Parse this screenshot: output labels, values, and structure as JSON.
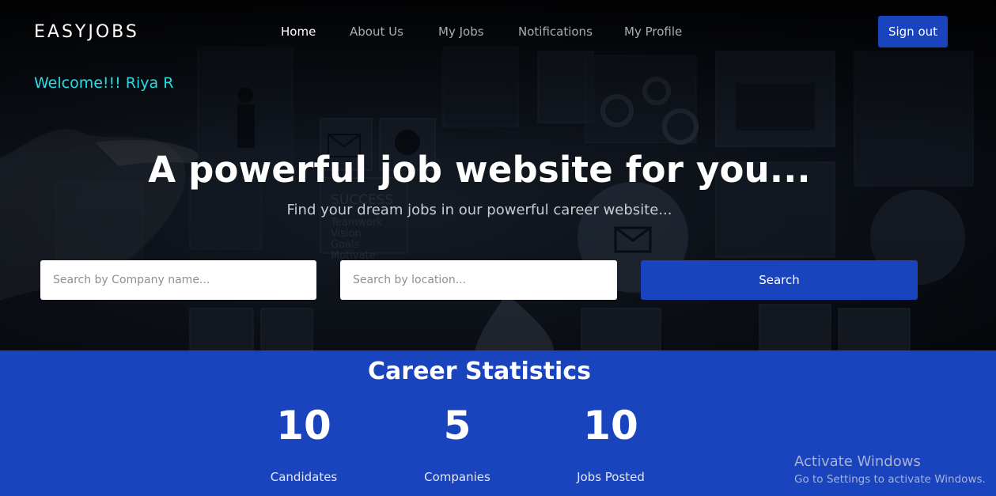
{
  "brand": "EASYJOBS",
  "nav": {
    "items": [
      {
        "label": "Home",
        "active": true
      },
      {
        "label": "About Us",
        "active": false
      },
      {
        "label": "My Jobs",
        "active": false
      },
      {
        "label": "Notifications",
        "active": false
      },
      {
        "label": "My Profile",
        "active": false
      }
    ],
    "signout_label": "Sign out"
  },
  "welcome": "Welcome!!! Riya R",
  "hero": {
    "headline": "A powerful job website for you...",
    "subline": "Find your dream jobs in our powerful career website...",
    "background_words": [
      "SUCCESS",
      "Teamwork",
      "Vision",
      "Goals",
      "Motivate"
    ]
  },
  "search": {
    "company_placeholder": "Search by Company name...",
    "location_placeholder": "Search by location...",
    "button_label": "Search"
  },
  "stats": {
    "title": "Career Statistics",
    "items": [
      {
        "value": "10",
        "label": "Candidates"
      },
      {
        "value": "5",
        "label": "Companies"
      },
      {
        "value": "10",
        "label": "Jobs Posted"
      }
    ]
  },
  "watermark": {
    "line1": "Activate Windows",
    "line2": "Go to Settings to activate Windows."
  },
  "colors": {
    "accent": "#1a44bd",
    "welcome": "#1fe0e6",
    "nav_inactive": "#a9adb4"
  }
}
